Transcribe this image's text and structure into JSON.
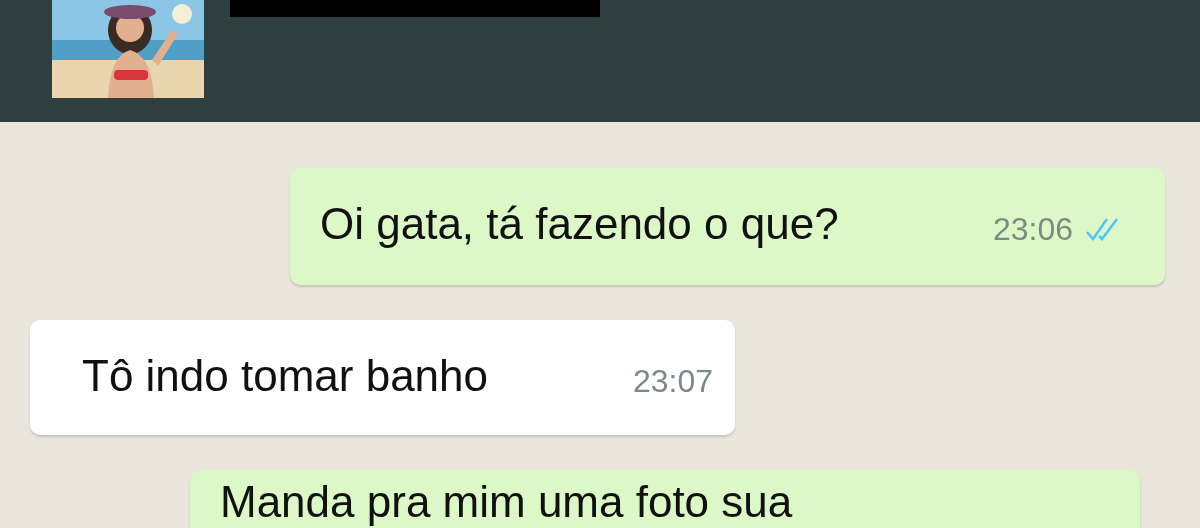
{
  "messages": [
    {
      "outgoing": true,
      "text": "Oi gata, tá fazendo o que?",
      "time": "23:06",
      "read": true
    },
    {
      "outgoing": false,
      "text": "Tô indo tomar banho",
      "time": "23:07"
    },
    {
      "outgoing": true,
      "text": "Manda pra mim uma foto sua"
    }
  ]
}
